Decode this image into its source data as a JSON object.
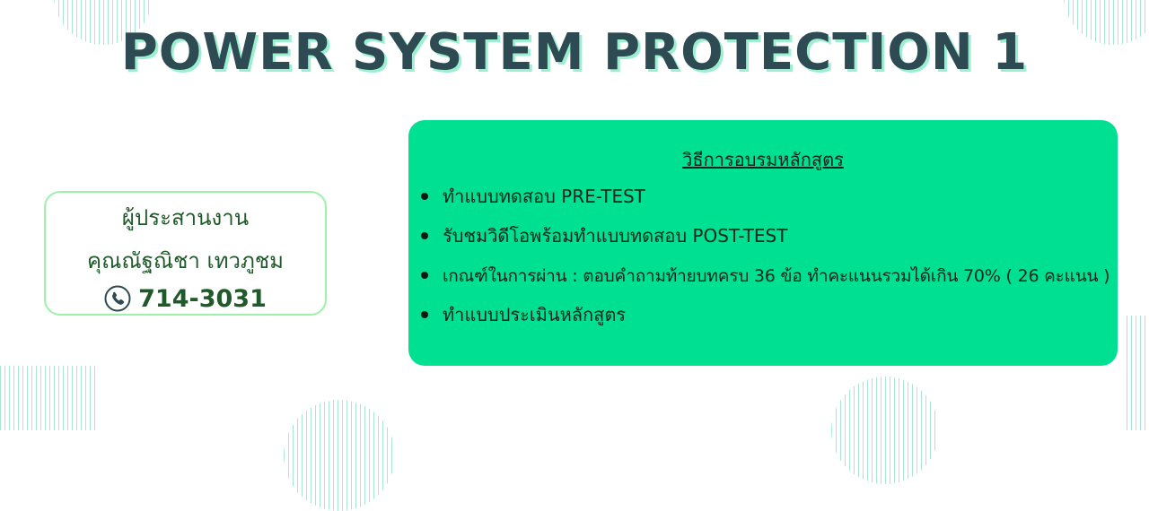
{
  "title": "POWER SYSTEM PROTECTION 1",
  "contact": {
    "role": "ผู้ประสานงาน",
    "name": "คุณณัฐณิชา เทวภูชม",
    "phone_icon": "phone-icon",
    "phone": "714-3031"
  },
  "training": {
    "heading": "วิธีการอบรมหลักสูตร",
    "items": [
      "ทำแบบทดสอบ PRE-TEST",
      "รับชมวิดีโอพร้อมทำแบบทดสอบ POST-TEST",
      "เกณฑ์ในการผ่าน : ตอบคำถามท้ายบทครบ 36 ข้อ ทำคะแนนรวมได้เกิน 70% ( 26 คะแนน )",
      "ทำแบบประเมินหลักสูตร"
    ]
  },
  "colors": {
    "title": "#2e4a52",
    "title_shadow": "#9af0cf",
    "info_bg": "#00e092",
    "contact_border": "#9ff0a9",
    "contact_text": "#1f5a2a"
  }
}
